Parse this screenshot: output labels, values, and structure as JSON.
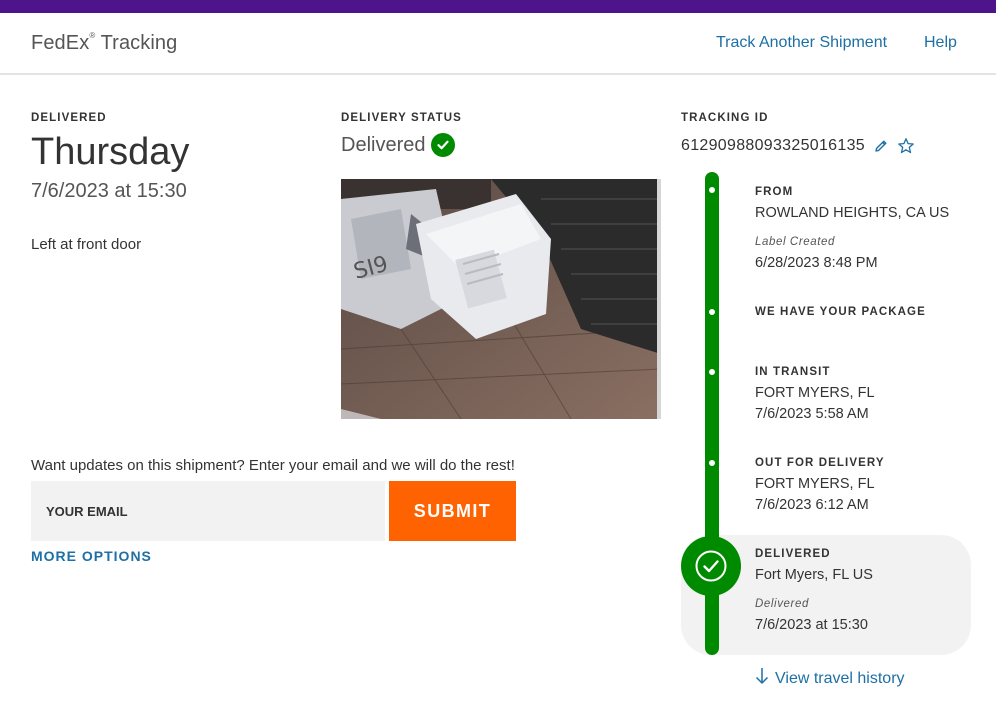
{
  "header": {
    "brand_name": "FedEx",
    "brand_mark": "®",
    "brand_section": " Tracking",
    "nav_track_another": "Track Another Shipment",
    "nav_help": "Help"
  },
  "delivered": {
    "label": "DELIVERED",
    "day": "Thursday",
    "date_time": "7/6/2023 at 15:30",
    "note": "Left at front door"
  },
  "delivery_status": {
    "label": "DELIVERY STATUS",
    "value": "Delivered",
    "icon": "check-circle-icon"
  },
  "photo": {
    "description_icon": "delivery-photo"
  },
  "updates": {
    "prompt": "Want updates on this shipment? Enter your email and we will do the rest!",
    "email_placeholder": "YOUR EMAIL",
    "submit_label": "SUBMIT",
    "more_options": "MORE OPTIONS"
  },
  "tracking": {
    "label": "TRACKING ID",
    "number": "612909880933250161​35",
    "edit_icon": "pencil-icon",
    "favorite_icon": "star-icon"
  },
  "timeline": {
    "from_title": "FROM",
    "from_location": "ROWLAND HEIGHTS, CA US",
    "from_sub_label": "Label Created",
    "from_date": "6/28/2023 8:48 PM",
    "have_package_title": "WE HAVE YOUR PACKAGE",
    "transit_title": "IN TRANSIT",
    "transit_location": "FORT MYERS, FL",
    "transit_date": "7/6/2023 5:58 AM",
    "ofd_title": "OUT FOR DELIVERY",
    "ofd_location": "FORT MYERS, FL",
    "ofd_date": "7/6/2023 6:12 AM",
    "delivered_title": "DELIVERED",
    "delivered_location": "Fort Myers, FL US",
    "delivered_sub_label": "Delivered",
    "delivered_date": "7/6/2023 at 15:30",
    "history_link": "View travel history"
  },
  "colors": {
    "brand_purple": "#4d148c",
    "submit_orange": "#ff6200",
    "success_green": "#008a00",
    "link_blue": "#1d6fa5"
  }
}
